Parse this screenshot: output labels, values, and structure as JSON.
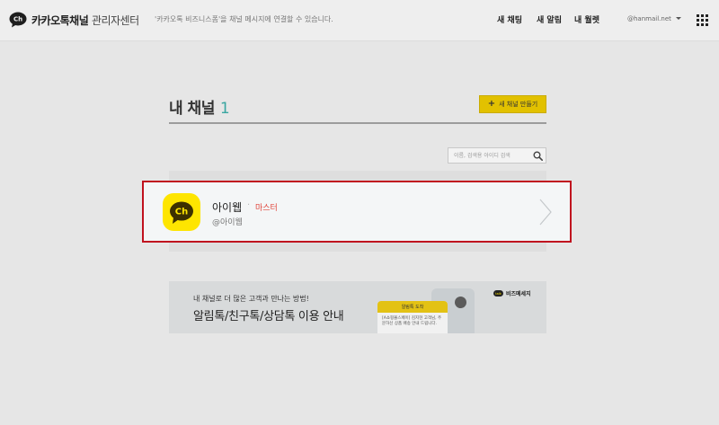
{
  "header": {
    "logo_text": "카카오톡채널",
    "logo_sub": "관리자센터",
    "description": "'카카오톡 비즈니스폼'을 채널 메시지에 연결할 수 있습니다.",
    "nav": [
      "새 채팅",
      "새 알림",
      "내 월렛"
    ],
    "user_email": "@hanmail.net"
  },
  "main": {
    "title": "내 채널",
    "count": "1",
    "create_button": "새 채널 만들기",
    "search_placeholder": "이름, 검색용 아이디 검색"
  },
  "channel": {
    "avatar_text": "Ch",
    "name": "아이웹",
    "separator": "·",
    "role": "마스터",
    "id": "@아이웹"
  },
  "banner": {
    "line1": "내 채널로 더 많은 고객과 만나는 방법!",
    "line2": "알림톡/친구톡/상담톡 이용 안내",
    "msg_title": "알림톡 도착",
    "msg_body": "[A쇼핑몰스페이] 김지현 고객님, 주문하신 상품 배송 안내 드립니다.",
    "brand_mark": "talk",
    "brand_text": "비즈메세지"
  },
  "colors": {
    "accent_yellow": "#fee500",
    "count_teal": "#3aa6a1",
    "role_red": "#e0463c",
    "highlight_border": "#c0121f"
  }
}
